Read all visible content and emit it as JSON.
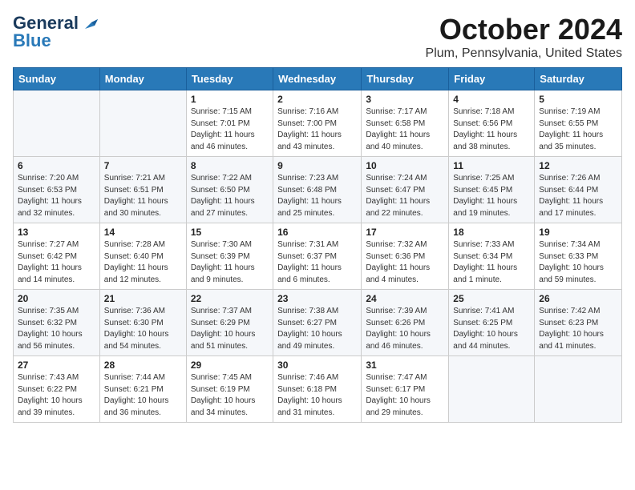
{
  "header": {
    "logo_general": "General",
    "logo_blue": "Blue",
    "month": "October 2024",
    "location": "Plum, Pennsylvania, United States"
  },
  "weekdays": [
    "Sunday",
    "Monday",
    "Tuesday",
    "Wednesday",
    "Thursday",
    "Friday",
    "Saturday"
  ],
  "weeks": [
    [
      {
        "day": "",
        "sunrise": "",
        "sunset": "",
        "daylight": ""
      },
      {
        "day": "",
        "sunrise": "",
        "sunset": "",
        "daylight": ""
      },
      {
        "day": "1",
        "sunrise": "Sunrise: 7:15 AM",
        "sunset": "Sunset: 7:01 PM",
        "daylight": "Daylight: 11 hours and 46 minutes."
      },
      {
        "day": "2",
        "sunrise": "Sunrise: 7:16 AM",
        "sunset": "Sunset: 7:00 PM",
        "daylight": "Daylight: 11 hours and 43 minutes."
      },
      {
        "day": "3",
        "sunrise": "Sunrise: 7:17 AM",
        "sunset": "Sunset: 6:58 PM",
        "daylight": "Daylight: 11 hours and 40 minutes."
      },
      {
        "day": "4",
        "sunrise": "Sunrise: 7:18 AM",
        "sunset": "Sunset: 6:56 PM",
        "daylight": "Daylight: 11 hours and 38 minutes."
      },
      {
        "day": "5",
        "sunrise": "Sunrise: 7:19 AM",
        "sunset": "Sunset: 6:55 PM",
        "daylight": "Daylight: 11 hours and 35 minutes."
      }
    ],
    [
      {
        "day": "6",
        "sunrise": "Sunrise: 7:20 AM",
        "sunset": "Sunset: 6:53 PM",
        "daylight": "Daylight: 11 hours and 32 minutes."
      },
      {
        "day": "7",
        "sunrise": "Sunrise: 7:21 AM",
        "sunset": "Sunset: 6:51 PM",
        "daylight": "Daylight: 11 hours and 30 minutes."
      },
      {
        "day": "8",
        "sunrise": "Sunrise: 7:22 AM",
        "sunset": "Sunset: 6:50 PM",
        "daylight": "Daylight: 11 hours and 27 minutes."
      },
      {
        "day": "9",
        "sunrise": "Sunrise: 7:23 AM",
        "sunset": "Sunset: 6:48 PM",
        "daylight": "Daylight: 11 hours and 25 minutes."
      },
      {
        "day": "10",
        "sunrise": "Sunrise: 7:24 AM",
        "sunset": "Sunset: 6:47 PM",
        "daylight": "Daylight: 11 hours and 22 minutes."
      },
      {
        "day": "11",
        "sunrise": "Sunrise: 7:25 AM",
        "sunset": "Sunset: 6:45 PM",
        "daylight": "Daylight: 11 hours and 19 minutes."
      },
      {
        "day": "12",
        "sunrise": "Sunrise: 7:26 AM",
        "sunset": "Sunset: 6:44 PM",
        "daylight": "Daylight: 11 hours and 17 minutes."
      }
    ],
    [
      {
        "day": "13",
        "sunrise": "Sunrise: 7:27 AM",
        "sunset": "Sunset: 6:42 PM",
        "daylight": "Daylight: 11 hours and 14 minutes."
      },
      {
        "day": "14",
        "sunrise": "Sunrise: 7:28 AM",
        "sunset": "Sunset: 6:40 PM",
        "daylight": "Daylight: 11 hours and 12 minutes."
      },
      {
        "day": "15",
        "sunrise": "Sunrise: 7:30 AM",
        "sunset": "Sunset: 6:39 PM",
        "daylight": "Daylight: 11 hours and 9 minutes."
      },
      {
        "day": "16",
        "sunrise": "Sunrise: 7:31 AM",
        "sunset": "Sunset: 6:37 PM",
        "daylight": "Daylight: 11 hours and 6 minutes."
      },
      {
        "day": "17",
        "sunrise": "Sunrise: 7:32 AM",
        "sunset": "Sunset: 6:36 PM",
        "daylight": "Daylight: 11 hours and 4 minutes."
      },
      {
        "day": "18",
        "sunrise": "Sunrise: 7:33 AM",
        "sunset": "Sunset: 6:34 PM",
        "daylight": "Daylight: 11 hours and 1 minute."
      },
      {
        "day": "19",
        "sunrise": "Sunrise: 7:34 AM",
        "sunset": "Sunset: 6:33 PM",
        "daylight": "Daylight: 10 hours and 59 minutes."
      }
    ],
    [
      {
        "day": "20",
        "sunrise": "Sunrise: 7:35 AM",
        "sunset": "Sunset: 6:32 PM",
        "daylight": "Daylight: 10 hours and 56 minutes."
      },
      {
        "day": "21",
        "sunrise": "Sunrise: 7:36 AM",
        "sunset": "Sunset: 6:30 PM",
        "daylight": "Daylight: 10 hours and 54 minutes."
      },
      {
        "day": "22",
        "sunrise": "Sunrise: 7:37 AM",
        "sunset": "Sunset: 6:29 PM",
        "daylight": "Daylight: 10 hours and 51 minutes."
      },
      {
        "day": "23",
        "sunrise": "Sunrise: 7:38 AM",
        "sunset": "Sunset: 6:27 PM",
        "daylight": "Daylight: 10 hours and 49 minutes."
      },
      {
        "day": "24",
        "sunrise": "Sunrise: 7:39 AM",
        "sunset": "Sunset: 6:26 PM",
        "daylight": "Daylight: 10 hours and 46 minutes."
      },
      {
        "day": "25",
        "sunrise": "Sunrise: 7:41 AM",
        "sunset": "Sunset: 6:25 PM",
        "daylight": "Daylight: 10 hours and 44 minutes."
      },
      {
        "day": "26",
        "sunrise": "Sunrise: 7:42 AM",
        "sunset": "Sunset: 6:23 PM",
        "daylight": "Daylight: 10 hours and 41 minutes."
      }
    ],
    [
      {
        "day": "27",
        "sunrise": "Sunrise: 7:43 AM",
        "sunset": "Sunset: 6:22 PM",
        "daylight": "Daylight: 10 hours and 39 minutes."
      },
      {
        "day": "28",
        "sunrise": "Sunrise: 7:44 AM",
        "sunset": "Sunset: 6:21 PM",
        "daylight": "Daylight: 10 hours and 36 minutes."
      },
      {
        "day": "29",
        "sunrise": "Sunrise: 7:45 AM",
        "sunset": "Sunset: 6:19 PM",
        "daylight": "Daylight: 10 hours and 34 minutes."
      },
      {
        "day": "30",
        "sunrise": "Sunrise: 7:46 AM",
        "sunset": "Sunset: 6:18 PM",
        "daylight": "Daylight: 10 hours and 31 minutes."
      },
      {
        "day": "31",
        "sunrise": "Sunrise: 7:47 AM",
        "sunset": "Sunset: 6:17 PM",
        "daylight": "Daylight: 10 hours and 29 minutes."
      },
      {
        "day": "",
        "sunrise": "",
        "sunset": "",
        "daylight": ""
      },
      {
        "day": "",
        "sunrise": "",
        "sunset": "",
        "daylight": ""
      }
    ]
  ]
}
